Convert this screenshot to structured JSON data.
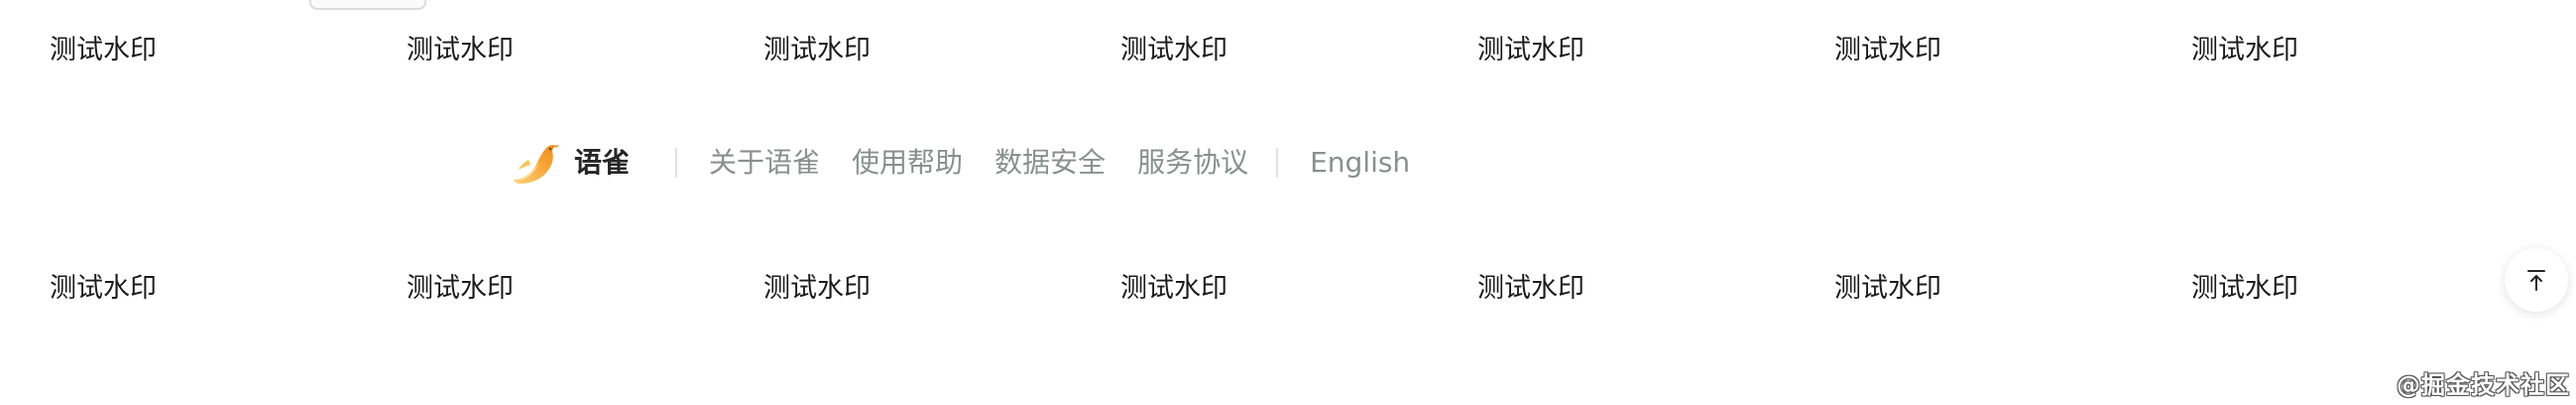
{
  "watermark": {
    "text": "测试水印"
  },
  "footer": {
    "brand_name": "语雀",
    "links": [
      "关于语雀",
      "使用帮助",
      "数据安全",
      "服务协议"
    ],
    "language_link": "English"
  },
  "back_to_top": {
    "icon": "arrow-up-to-top-icon"
  },
  "site_watermark": {
    "text": "@掘金技术社区"
  },
  "colors": {
    "link": "#8a8f8d",
    "brand_text": "#262626",
    "logo_orange": "#f5a623",
    "logo_light": "#ffd27a"
  }
}
